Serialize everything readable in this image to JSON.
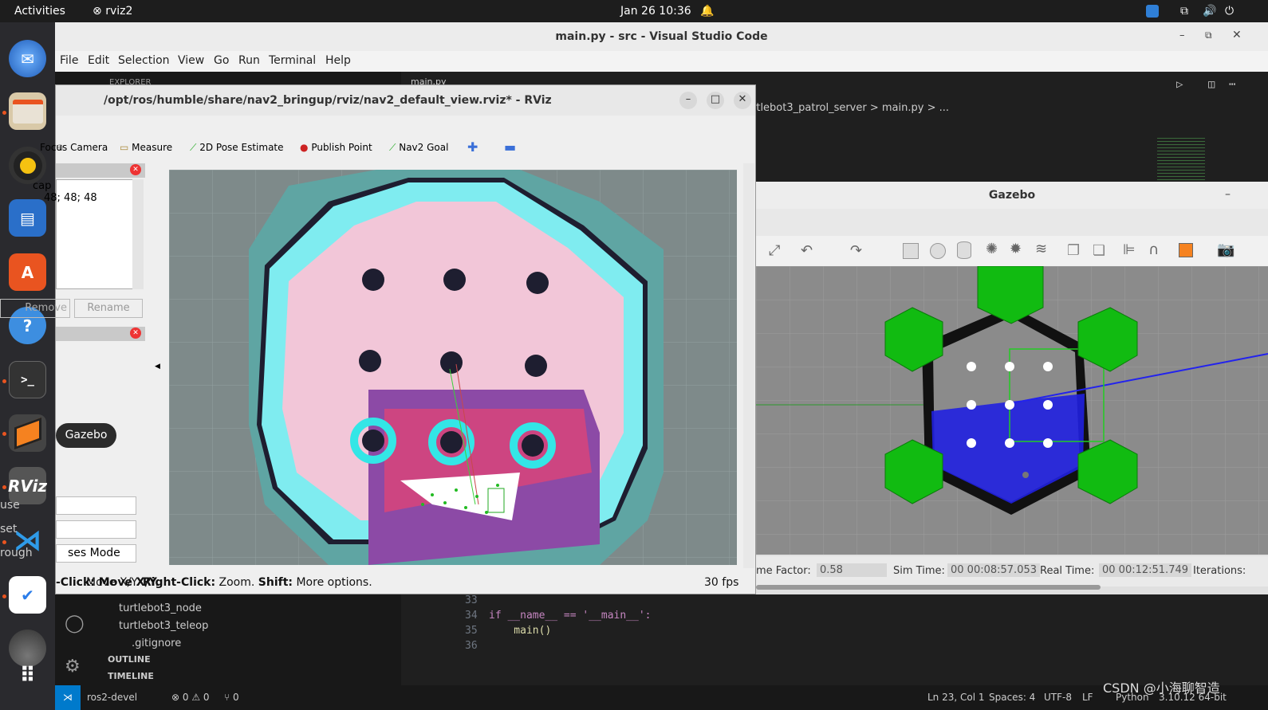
{
  "topbar": {
    "activities": "Activities",
    "app": "rviz2",
    "datetime": "Jan 26  10:36"
  },
  "vscode": {
    "title": "main.py - src - Visual Studio Code",
    "menu": [
      "File",
      "Edit",
      "Selection",
      "View",
      "Go",
      "Run",
      "Terminal",
      "Help"
    ],
    "explorer_label": "EXPLORER",
    "tab": "main.py",
    "breadcrumb": "rtlebot3_patrol_server  >  main.py  > ...",
    "tree": [
      "turtlebot3_node",
      "turtlebot3_teleop",
      ".gitignore"
    ],
    "sections": [
      "OUTLINE",
      "TIMELINE"
    ],
    "lines": [
      {
        "n": "33",
        "code": ""
      },
      {
        "n": "34",
        "code": "if __name__ == '__main__':"
      },
      {
        "n": "35",
        "code": "    main()"
      },
      {
        "n": "36",
        "code": ""
      }
    ],
    "status": {
      "branch": "ros2-devel",
      "problems": "⊗ 0 ⚠ 0",
      "ports": "⑂ 0",
      "position": "Ln 23, Col 1",
      "spaces": "Spaces: 4",
      "encoding": "UTF-8",
      "eol": "LF",
      "lang": "Python",
      "version": "3.10.12 64-bit"
    }
  },
  "rviz": {
    "title": "/opt/ros/humble/share/nav2_bringup/rviz/nav2_default_view.rviz* - RViz",
    "tools": [
      "Focus Camera",
      "Measure",
      "2D Pose Estimate",
      "Publish Point",
      "Nav2 Goal"
    ],
    "panel_text": [
      "cap",
      "48; 48; 48"
    ],
    "remove": "Remove",
    "rename": "Rename",
    "mode": "ses Mode",
    "partial": [
      "use",
      "set",
      "rough"
    ],
    "status_left": "-Click: Move X/Y. ",
    "status_right_bold": "Right-Click:",
    "status_zoom": " Zoom. ",
    "status_shift": "Shift:",
    "status_more": " More options.",
    "fps": "30 fps"
  },
  "gazebo": {
    "title": "Gazebo",
    "rtf_label": "me Factor:",
    "rtf": "0.58",
    "sim_label": "Sim Time:",
    "sim": "00 00:08:57.053",
    "real_label": "Real Time:",
    "real": "00 00:12:51.749",
    "iter_label": "Iterations:"
  },
  "dock": {
    "tooltip": "Gazebo"
  },
  "watermark": "CSDN @小海聊智造",
  "colors": {
    "ubuntu_orange": "#e95420",
    "vs_blue": "#007acc",
    "map_bg": "#7e8a8a"
  }
}
